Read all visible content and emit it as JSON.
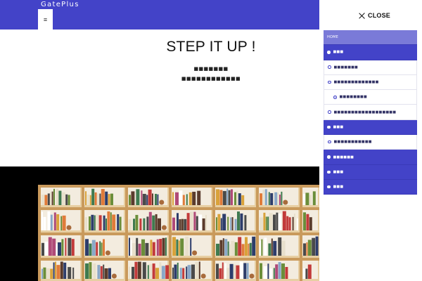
{
  "header": {
    "logo": "GatePlus",
    "menu_button_glyph": "≡"
  },
  "hero": {
    "title": "STEP IT UP !",
    "line1": "■■■■■■■",
    "line2": "■■■■■■■■■■■■"
  },
  "photo": {
    "subject": "bookshelf-photo"
  },
  "side_menu": {
    "close_label": "CLOSE",
    "items": [
      {
        "label": "HOME",
        "style": "active"
      },
      {
        "label": "■■■",
        "style": "filled"
      },
      {
        "label": "■■■■■■■",
        "style": "outline"
      },
      {
        "label": "■■■■■■■■■■■■■",
        "style": "outline"
      },
      {
        "label": "■■■■■■■■",
        "style": "outline-indent"
      },
      {
        "label": "■■■■■■■■■■■■■■■■■■",
        "style": "outline"
      },
      {
        "label": "■■■",
        "style": "filled"
      },
      {
        "label": "■■■■■■■■■■■",
        "style": "outline"
      },
      {
        "label": "■■■■■■",
        "style": "filled"
      },
      {
        "label": "■■■",
        "style": "filled"
      },
      {
        "label": "■■■",
        "style": "filled"
      }
    ]
  },
  "colors": {
    "accent": "#4343c8",
    "active": "#7a7ad8"
  }
}
